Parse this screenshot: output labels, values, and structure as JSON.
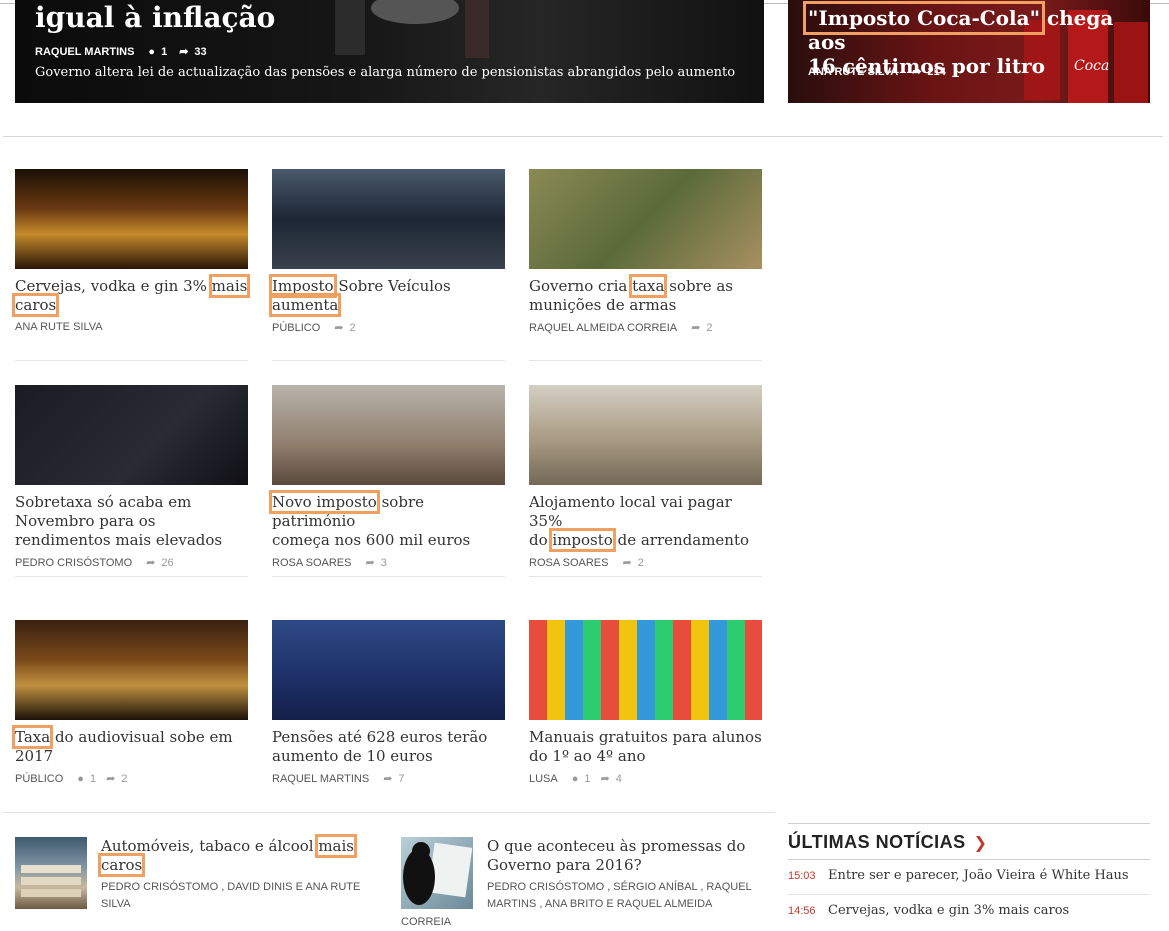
{
  "hero_left": {
    "title": "igual à inflação",
    "author": "RAQUEL MARTINS",
    "comments": "1",
    "shares": "33",
    "summary": "Governo altera lei de actualização das pensões e alarga número de pensionistas abrangidos pelo aumento"
  },
  "hero_right": {
    "title_highlight": "\"Imposto Coca-Cola\"",
    "title_rest_1": " chega aos",
    "title_rest_2": "16 cêntimos por litro",
    "author": "ANA RUTE SILVA",
    "shares": "214"
  },
  "cards": [
    {
      "pre": "Cervejas, vodka e gin 3% ",
      "hl": "mais",
      "post": "",
      "line2_hl": "caros",
      "line2": "",
      "author": "ANA RUTE SILVA",
      "comments": "",
      "shares": ""
    },
    {
      "pre": "",
      "hl": "Imposto",
      "post": " Sobre Veículos",
      "line2_hl": "aumenta",
      "line2": "",
      "author": "PÚBLICO",
      "comments": "",
      "shares": "2"
    },
    {
      "pre": "Governo cria ",
      "hl": "taxa",
      "post": " sobre as",
      "line2_hl": "",
      "line2": "munições de armas",
      "author": "RAQUEL ALMEIDA CORREIA",
      "comments": "",
      "shares": "2"
    },
    {
      "pre": "Sobretaxa só acaba em",
      "hl": "",
      "post": "",
      "line2_hl": "",
      "line2": "Novembro para os rendimentos mais elevados",
      "author": "PEDRO CRISÓSTOMO",
      "comments": "",
      "shares": "26"
    },
    {
      "pre": "",
      "hl": "Novo imposto",
      "post": " sobre património",
      "line2_hl": "",
      "line2": "começa nos 600 mil euros",
      "author": "ROSA SOARES",
      "comments": "",
      "shares": "3"
    },
    {
      "pre": "Alojamento local vai pagar 35%",
      "hl": "",
      "post": "",
      "line2_pre": "do ",
      "line2_hl": "imposto",
      "line2": " de arrendamento",
      "author": "ROSA SOARES",
      "comments": "",
      "shares": "2"
    },
    {
      "pre": "",
      "hl": "Taxa",
      "post": " do audiovisual sobe em",
      "line2_hl": "",
      "line2": "2017",
      "author": "PÚBLICO",
      "comments": "1",
      "shares": "2"
    },
    {
      "pre": "Pensões até 628 euros terão",
      "hl": "",
      "post": "",
      "line2_hl": "",
      "line2": "aumento de 10 euros",
      "author": "RAQUEL MARTINS",
      "comments": "",
      "shares": "7"
    },
    {
      "pre": "Manuais gratuitos para alunos",
      "hl": "",
      "post": "",
      "line2_hl": "",
      "line2": "do 1º ao 4º ano",
      "author": "LUSA",
      "comments": "1",
      "shares": "4"
    }
  ],
  "bottom": [
    {
      "pre": "Automóveis, tabaco e álcool ",
      "hl": "mais",
      "line2_hl": "caros",
      "authors_1": "PEDRO CRISÓSTOMO , DAVID DINIS e ANA RUTE",
      "authors_2": "SILVA"
    },
    {
      "line1": "O que aconteceu às promessas do",
      "line2": "Governo para 2016?",
      "authors_1": "PEDRO CRISÓSTOMO , SÉRGIO ANÍBAL , RAQUEL",
      "authors_2": "MARTINS , ANA BRITO e RAQUEL ALMEIDA",
      "authors_3": "CORREIA"
    }
  ],
  "latest": {
    "heading": "ÚLTIMAS NOTÍCIAS",
    "items": [
      {
        "time": "15:03",
        "text": "Entre ser e parecer, João Vieira é White Haus"
      },
      {
        "time": "14:56",
        "text": "Cervejas, vodka e gin 3% mais caros"
      }
    ]
  },
  "icons": {
    "comment": "comment-icon",
    "share": "share-icon",
    "chevron": "chevron-right-icon"
  },
  "colors": {
    "highlight": "#f0a060",
    "accent": "#c0392b"
  }
}
